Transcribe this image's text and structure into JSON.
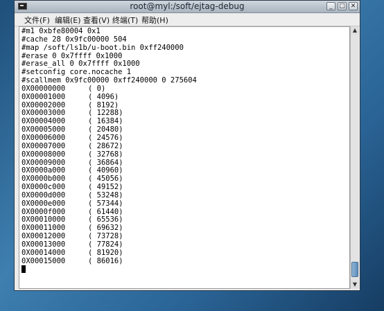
{
  "window": {
    "title": "root@myl:/soft/ejtag-debug",
    "controls": {
      "minimize": "_",
      "maximize": "□",
      "close": "✕"
    }
  },
  "menu": [
    "文件(F)",
    "编辑(E)",
    "查看(V)",
    "终端(T)",
    "帮助(H)"
  ],
  "terminal": {
    "commands": [
      "#m1 0xbfe80004 0x1",
      "#cache 28 0x9fc00000 504",
      "#map /soft/ls1b/u-boot.bin 0xff240000",
      "#erase 0 0x7ffff 0x1000",
      "#erase_all 0 0x7ffff 0x1000",
      "#setconfig core.nocache 1",
      "#scallmem 0x9fc00000 0xff240000 0 275604"
    ],
    "progress": [
      {
        "addr": "0X00000000",
        "bytes": "( 0)"
      },
      {
        "addr": "0X00001000",
        "bytes": "( 4096)"
      },
      {
        "addr": "0X00002000",
        "bytes": "( 8192)"
      },
      {
        "addr": "0X00003000",
        "bytes": "( 12288)"
      },
      {
        "addr": "0X00004000",
        "bytes": "( 16384)"
      },
      {
        "addr": "0X00005000",
        "bytes": "( 20480)"
      },
      {
        "addr": "0X00006000",
        "bytes": "( 24576)"
      },
      {
        "addr": "0X00007000",
        "bytes": "( 28672)"
      },
      {
        "addr": "0X00008000",
        "bytes": "( 32768)"
      },
      {
        "addr": "0X00009000",
        "bytes": "( 36864)"
      },
      {
        "addr": "0X0000a000",
        "bytes": "( 40960)"
      },
      {
        "addr": "0X0000b000",
        "bytes": "( 45056)"
      },
      {
        "addr": "0X0000c000",
        "bytes": "( 49152)"
      },
      {
        "addr": "0X0000d000",
        "bytes": "( 53248)"
      },
      {
        "addr": "0X0000e000",
        "bytes": "( 57344)"
      },
      {
        "addr": "0X0000f000",
        "bytes": "( 61440)"
      },
      {
        "addr": "0X00010000",
        "bytes": "( 65536)"
      },
      {
        "addr": "0X00011000",
        "bytes": "( 69632)"
      },
      {
        "addr": "0X00012000",
        "bytes": "( 73728)"
      },
      {
        "addr": "0X00013000",
        "bytes": "( 77824)"
      },
      {
        "addr": "0X00014000",
        "bytes": "( 81920)"
      },
      {
        "addr": "0X00015000",
        "bytes": "( 86016)"
      }
    ]
  },
  "colors": {
    "terminal_bg": "#ffffff",
    "terminal_fg": "#000000",
    "desktop": "#2a6496"
  }
}
